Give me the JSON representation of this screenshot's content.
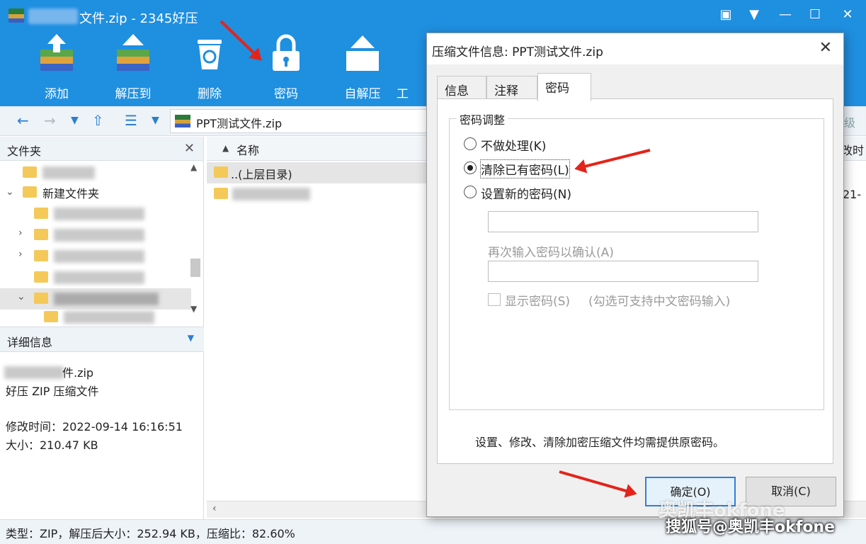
{
  "app": {
    "title": "文件.zip - 2345好压"
  },
  "toolbar": {
    "items": [
      {
        "label": "添加",
        "icon": "add-archive-icon"
      },
      {
        "label": "解压到",
        "icon": "extract-icon"
      },
      {
        "label": "删除",
        "icon": "delete-icon"
      },
      {
        "label": "密码",
        "icon": "lock-icon"
      },
      {
        "label": "自解压",
        "icon": "self-extract-icon"
      },
      {
        "label": "工"
      }
    ]
  },
  "address": {
    "path": "PPT测试文件.zip",
    "right_fragment": "级"
  },
  "left_pane": {
    "header": "文件夹",
    "tree": [
      {
        "label": "新建文件夹"
      }
    ],
    "detail_header": "详细信息",
    "detail": {
      "filename_suffix": "件.zip",
      "type": "好压 ZIP 压缩文件",
      "modified": "修改时间：2022-09-14 16:16:51",
      "size": "大小：210.47 KB"
    }
  },
  "list": {
    "column_name": "名称",
    "column_right_fragment": "改时",
    "row_parent": "..(上层目录)",
    "row_date_fragment": "21-"
  },
  "status": {
    "text": "类型：ZIP，解压后大小：252.94 KB，压缩比：82.60%"
  },
  "dialog": {
    "title": "压缩文件信息: PPT测试文件.zip",
    "tabs": [
      {
        "label": "信息",
        "active": false
      },
      {
        "label": "注释",
        "active": false
      },
      {
        "label": "密码",
        "active": true
      }
    ],
    "group_title": "密码调整",
    "options": [
      {
        "label": "不做处理(K)",
        "checked": false
      },
      {
        "label": "清除已有密码(L)",
        "checked": true
      },
      {
        "label": "设置新的密码(N)",
        "checked": false
      }
    ],
    "reenter_label": "再次输入密码以确认(A)",
    "show_password_label": "显示密码(S)",
    "show_password_hint": "(勾选可支持中文密码输入)",
    "note": "设置、修改、清除加密压缩文件均需提供原密码。",
    "ok": "确定(O)",
    "cancel": "取消(C)"
  },
  "watermark": {
    "text1": "奥凯丰okfone",
    "text2": "搜狐号@奥凯丰okfone"
  },
  "colors": {
    "toolbar_blue": "#1f8fe0",
    "arrow_red": "#e3241b"
  }
}
